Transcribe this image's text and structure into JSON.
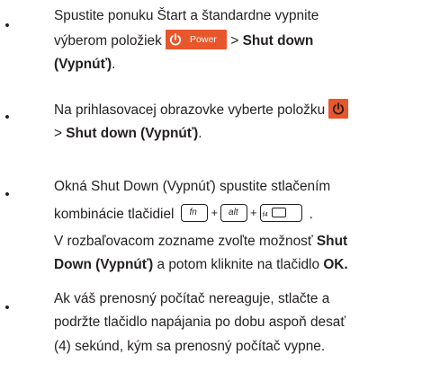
{
  "items": [
    {
      "bullet": "•",
      "lines": {
        "l1": "Spustite ponuku Štart a štandardne vypnite",
        "l2_pre": "výberom položiek ",
        "l2_icon_text": "Power",
        "l2_sep": " > ",
        "l2_bold": "Shut down",
        "l3_bold": "(Vypnúť)",
        "l3_end": "."
      }
    },
    {
      "bullet": "•",
      "lines": {
        "l1": "Na prihlasovacej obrazovke vyberte položku ",
        "l2_sep": "> ",
        "l2_bold": "Shut down (Vypnúť)",
        "l2_end": "."
      }
    },
    {
      "bullet": "•",
      "lines": {
        "l1": "Okná Shut Down (Vypnúť) spustite stlačením",
        "l2_pre": "kombinácie tlačidiel",
        "key1": "fn",
        "plus": "+",
        "key2": "alt",
        "key3": "f4",
        "l2_end": ".",
        "l3_pre": "V rozbaľovacom zozname zvoľte možnosť ",
        "l3_bold": "Shut",
        "l4_bold": "Down (Vypnúť)",
        "l4_mid": " a potom kliknite na tlačidlo ",
        "l4_bold2": "OK."
      }
    },
    {
      "bullet": "•",
      "lines": {
        "l1": "Ak váš prenosný počítač nereaguje, stlačte a",
        "l2": "podržte tlačidlo napájania po dobu aspoň desať",
        "l3": "(4) sekúnd, kým sa prenosný počítač vypne."
      }
    }
  ],
  "colors": {
    "text": "#231f20",
    "power_badge": "#e8562b"
  },
  "icons": [
    "power-icon",
    "lock-icon"
  ]
}
